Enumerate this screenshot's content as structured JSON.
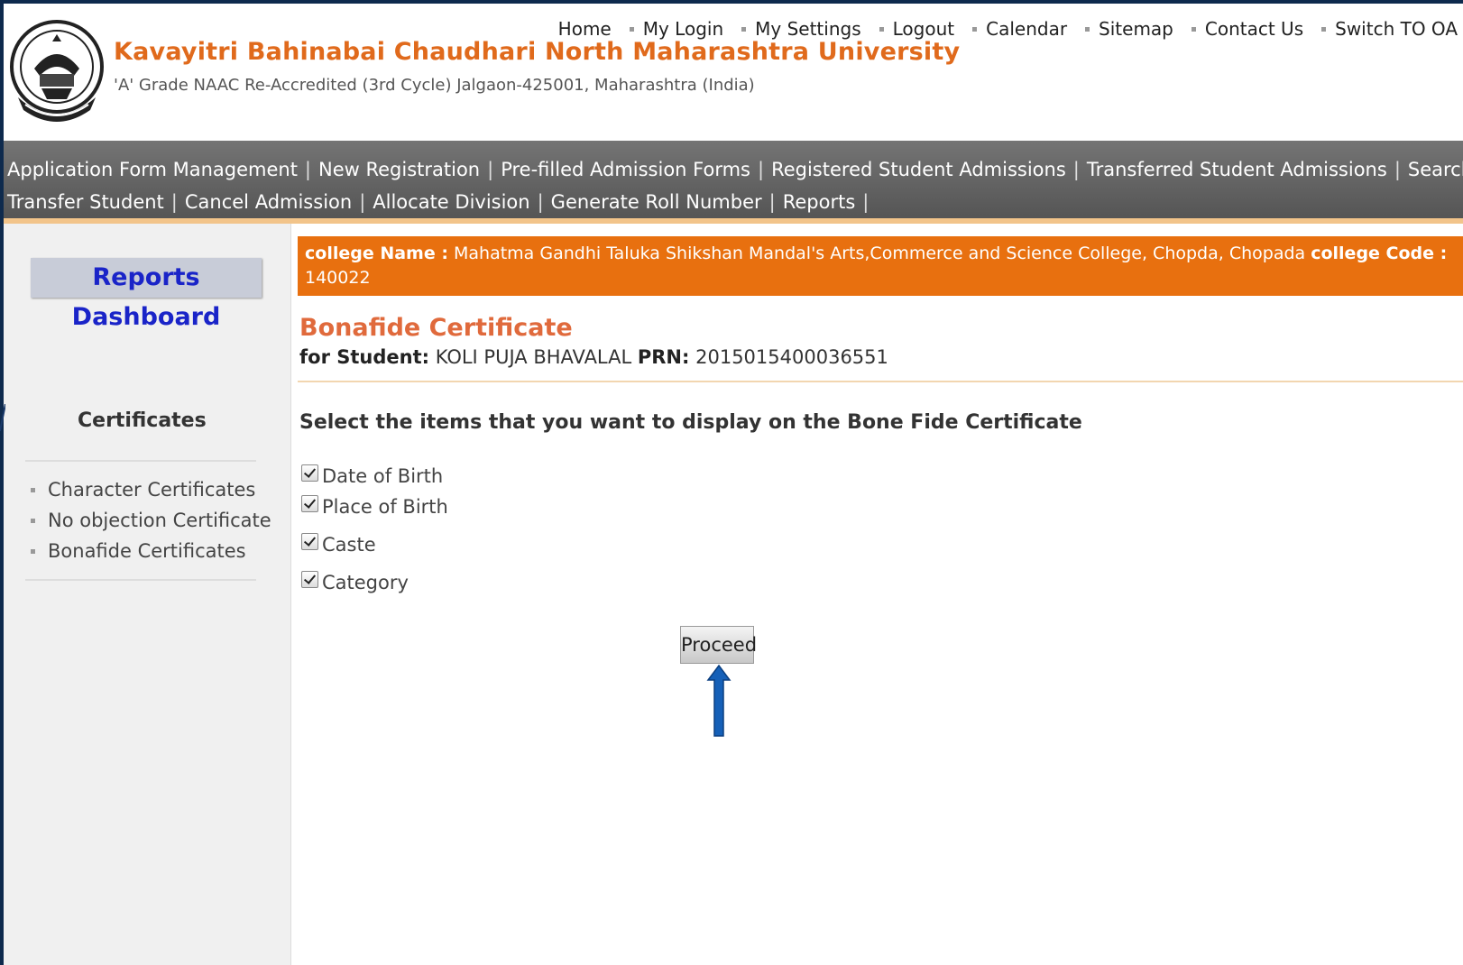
{
  "header": {
    "university_name": "Kavayitri Bahinabai Chaudhari North Maharashtra University",
    "subtitle": "'A' Grade NAAC Re-Accredited (3rd Cycle) Jalgaon-425001, Maharashtra (India)",
    "logo_icon": "university-seal-icon",
    "top_links": [
      "Home",
      "My Login",
      "My Settings",
      "Logout",
      "Calendar",
      "Sitemap",
      "Contact Us",
      "Switch TO OA"
    ]
  },
  "nav": {
    "row1": [
      "Application Form Management",
      "New Registration",
      "Pre-filled Admission Forms",
      "Registered Student Admissions",
      "Transferred Student Admissions",
      "Search Student"
    ],
    "row2": [
      "Transfer Student",
      "Cancel Admission",
      "Allocate Division",
      "Generate Roll Number",
      "Reports"
    ],
    "separator": "|"
  },
  "sidebar": {
    "dashboard_label": "Reports Dashboard",
    "certificates_heading": "Certificates",
    "items": [
      "Character Certificates",
      "No objection Certificate",
      "Bonafide Certificates"
    ]
  },
  "college": {
    "name_label": "college Name :",
    "name_value": "Mahatma Gandhi Taluka Shikshan Mandal's Arts,Commerce and Science College, Chopda, Chopada",
    "code_label": "college Code :",
    "code_value": "140022"
  },
  "certificate": {
    "title": "Bonafide Certificate",
    "student_label": "for Student:",
    "student_name": "KOLI PUJA BHAVALAL",
    "prn_label": "PRN:",
    "prn_value": "2015015400036551",
    "instruction": "Select the items that you want to display on the Bone Fide Certificate",
    "options": [
      {
        "label": "Date of Birth",
        "checked": true
      },
      {
        "label": "Place of Birth",
        "checked": true
      },
      {
        "label": "Caste",
        "checked": true
      },
      {
        "label": "Category",
        "checked": true
      }
    ],
    "proceed_label": "Proceed"
  },
  "colors": {
    "brand_orange": "#e06a1c",
    "college_bar": "#e8700f",
    "nav_bg": "#5f5f5f",
    "dashboard_text": "#1a24c8",
    "annotation_arrow": "#1560b8"
  }
}
